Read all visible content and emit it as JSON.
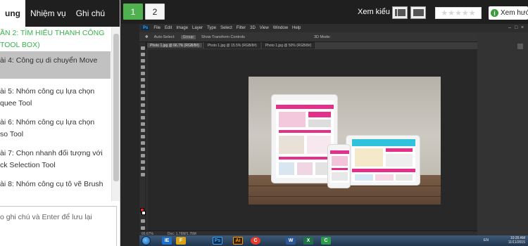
{
  "left_panel": {
    "tabs": [
      {
        "label": "ung",
        "active": true
      },
      {
        "label": "Nhiệm vụ",
        "active": false
      },
      {
        "label": "Ghi chú",
        "active": false
      }
    ],
    "section_title": [
      "ẦN 2: TÌM HIỂU THANH CÔNG",
      "TOOL BOX)"
    ],
    "lessons": [
      {
        "line1": "ài 4: Công cụ di chuyển Move",
        "line2": "",
        "active": true
      },
      {
        "line1": "ài 5: Nhóm công cụ lựa chọn",
        "line2": "quee Tool",
        "active": false
      },
      {
        "line1": "ài 6: Nhóm công cụ lựa chọn",
        "line2": "so Tool",
        "active": false
      },
      {
        "line1": "ài 7: Chọn nhanh đối tượng với",
        "line2": "ck Selection Tool",
        "active": false
      },
      {
        "line1": "ài 8: Nhóm công cụ tô vẽ Brush",
        "line2": "",
        "active": false
      }
    ],
    "note_placeholder": "o ghi chú và Enter để lưu lại"
  },
  "topbar": {
    "pages": [
      "1",
      "2"
    ],
    "active_page": "1",
    "view_label": "Xem kiểu",
    "rating_stars": "★★★★★",
    "watch_label": "Xem hướn",
    "accent_green": "#4fb24f"
  },
  "photoshop": {
    "logo": "Ps",
    "menu": [
      "File",
      "Edit",
      "Image",
      "Layer",
      "Type",
      "Select",
      "Filter",
      "3D",
      "View",
      "Window",
      "Help"
    ],
    "options": [
      "Auto-Select:",
      "Group",
      "Show Transform Controls",
      "3D Mode:"
    ],
    "doc_tabs": [
      {
        "label": "Photo 1.jpg @ 66.7% (RGB/8#)",
        "active": true
      },
      {
        "label": "Photo 1.jpg @ 15.5% (RGB/8#)",
        "active": false
      },
      {
        "label": "Photo 1.jpg @ 50% (RGB/8#)",
        "active": false
      }
    ],
    "status_zoom": "66.67%",
    "status_doc": "Doc: 1.76M/1.76M"
  },
  "taskbar": {
    "icons": [
      "IE",
      "F",
      "Ps",
      "Ai",
      "C",
      "W",
      "X",
      "C"
    ],
    "lang": "EN",
    "clock_time": "10:35 AM",
    "clock_date": "11/11/2015"
  }
}
